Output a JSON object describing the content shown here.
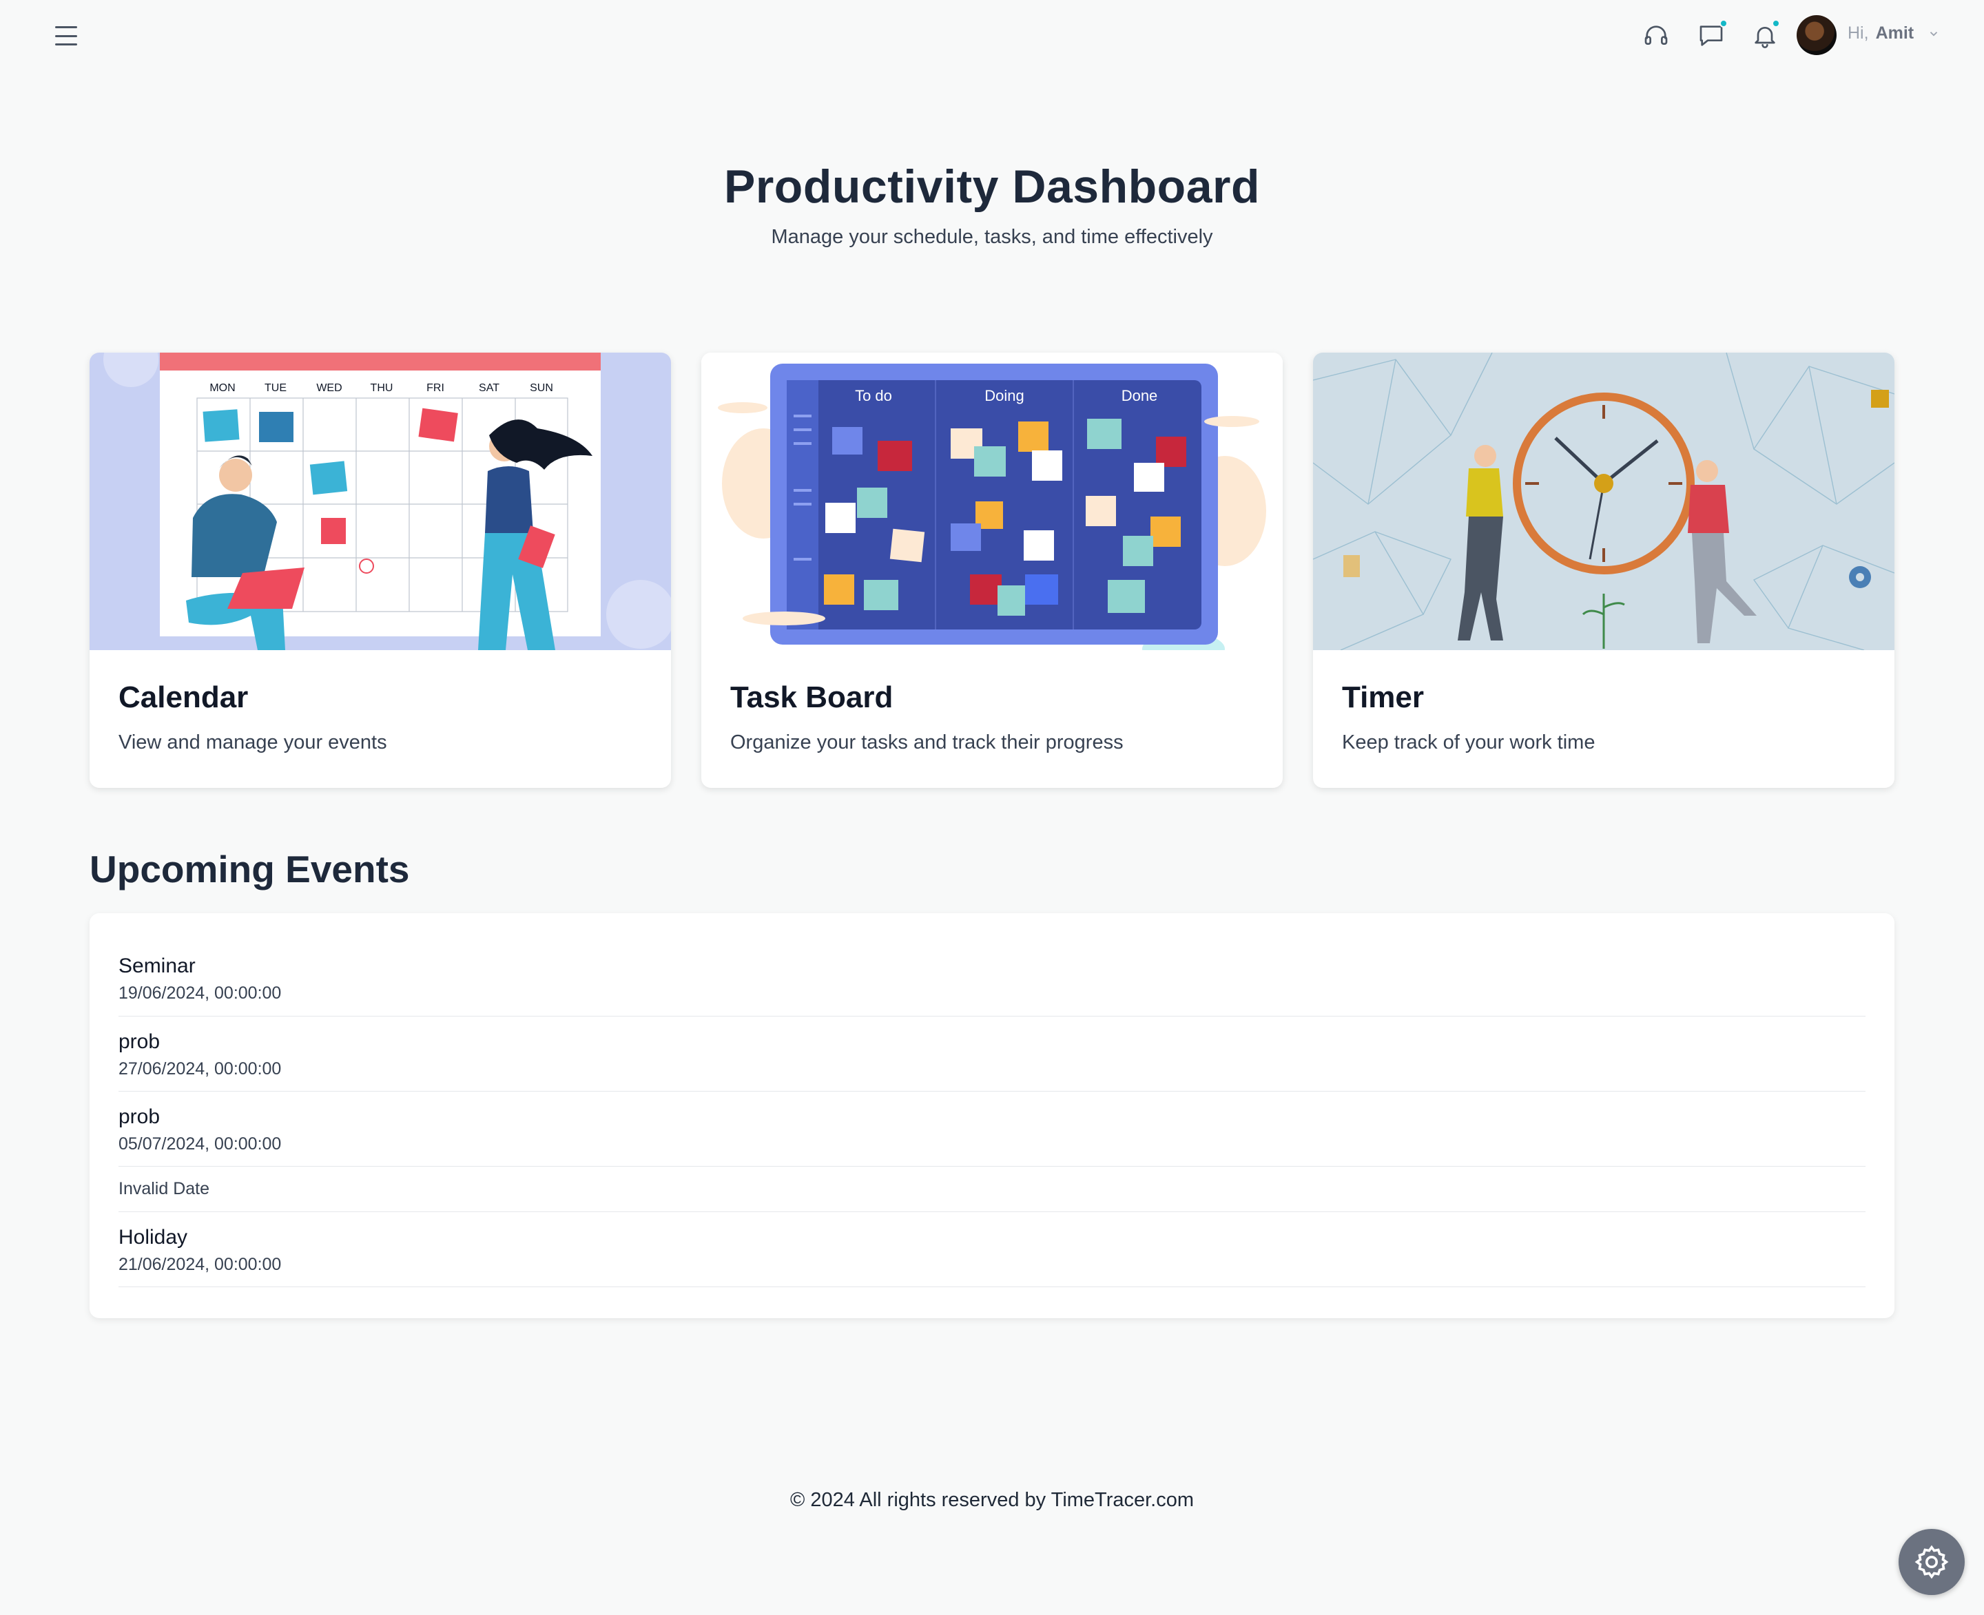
{
  "topbar": {
    "menu_icon": "hamburger-menu-icon",
    "support_icon": "headset-icon",
    "chat_icon": "chat-bubble-icon",
    "bell_icon": "bell-icon",
    "greeting": "Hi,",
    "user_name": "Amit",
    "accent": "#14b8c7"
  },
  "header": {
    "title": "Productivity Dashboard",
    "subtitle": "Manage your schedule, tasks, and time effectively"
  },
  "cards": [
    {
      "title": "Calendar",
      "description": "View and manage your events",
      "illustration_days": [
        "MON",
        "TUE",
        "WED",
        "THU",
        "FRI",
        "SAT",
        "SUN"
      ]
    },
    {
      "title": "Task Board",
      "description": "Organize your tasks and track their progress",
      "columns": [
        "To do",
        "Doing",
        "Done"
      ]
    },
    {
      "title": "Timer",
      "description": "Keep track of your work time"
    }
  ],
  "events_section": {
    "title": "Upcoming Events",
    "items": [
      {
        "name": "Seminar",
        "date": "19/06/2024, 00:00:00"
      },
      {
        "name": "prob",
        "date": "27/06/2024, 00:00:00"
      },
      {
        "name": "prob",
        "date": "05/07/2024, 00:00:00"
      },
      {
        "name": "",
        "date": "Invalid Date"
      },
      {
        "name": "Holiday",
        "date": "21/06/2024, 00:00:00"
      }
    ]
  },
  "footer": {
    "text": "© 2024 All rights reserved by TimeTracer.com"
  },
  "fab": {
    "icon": "gear-icon"
  }
}
